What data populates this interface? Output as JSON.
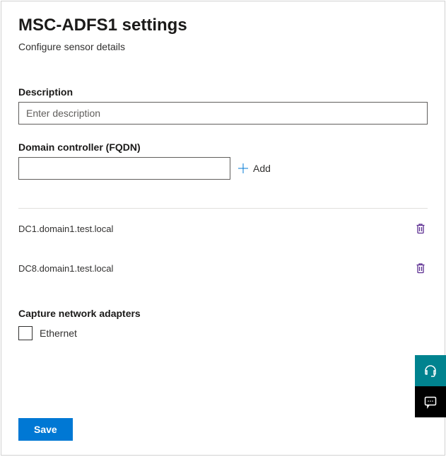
{
  "header": {
    "title": "MSC-ADFS1 settings",
    "subtitle": "Configure sensor details"
  },
  "form": {
    "description_label": "Description",
    "description_placeholder": "Enter description",
    "description_value": "",
    "fqdn_label": "Domain controller (FQDN)",
    "fqdn_value": "",
    "add_label": "Add"
  },
  "dc_list": [
    {
      "name": "DC1.domain1.test.local"
    },
    {
      "name": "DC8.domain1.test.local"
    }
  ],
  "adapters": {
    "label": "Capture network adapters",
    "items": [
      {
        "label": "Ethernet",
        "checked": false
      }
    ]
  },
  "actions": {
    "save_label": "Save"
  }
}
